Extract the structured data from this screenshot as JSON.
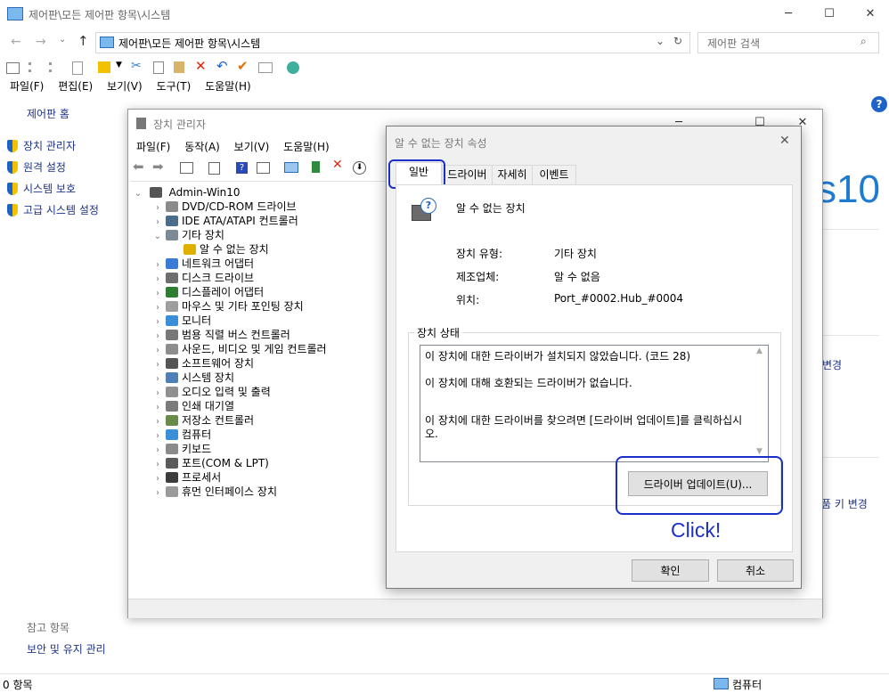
{
  "main_window": {
    "title": "제어판\\모든 제어판 항목\\시스템",
    "address": "제어판\\모든 제어판 항목\\시스템",
    "search_placeholder": "제어판 검색",
    "menu": [
      "파일(F)",
      "편집(E)",
      "보기(V)",
      "도구(T)",
      "도움말(H)"
    ],
    "left_home": "제어판 홈",
    "left_links": [
      "장치 관리자",
      "원격 설정",
      "시스템 보호",
      "고급 시스템 설정"
    ],
    "see_also": "참고 항목",
    "see_also_link": "보안 및 유지 관리",
    "win10_text": "s10",
    "change_link": "변경",
    "product_key_link": "품 키 변경",
    "status_left": "0 항목",
    "status_right": "컴퓨터"
  },
  "device_manager": {
    "title": "장치 관리자",
    "menu": [
      "파일(F)",
      "동작(A)",
      "보기(V)",
      "도움말(H)"
    ],
    "root": "Admin-Win10",
    "items": [
      {
        "label": "DVD/CD-ROM 드라이브",
        "expanded": false,
        "level": 1,
        "color": "#8a8a8a"
      },
      {
        "label": "IDE ATA/ATAPI 컨트롤러",
        "expanded": false,
        "level": 1,
        "color": "#4a6d8c"
      },
      {
        "label": "기타 장치",
        "expanded": true,
        "level": 1,
        "color": "#7c8a96"
      },
      {
        "label": "알 수 없는 장치",
        "expanded": null,
        "level": 2,
        "color": "#e0b000"
      },
      {
        "label": "네트워크 어댑터",
        "expanded": false,
        "level": 1,
        "color": "#3a7bd5"
      },
      {
        "label": "디스크 드라이브",
        "expanded": false,
        "level": 1,
        "color": "#6e6e6e"
      },
      {
        "label": "디스플레이 어댑터",
        "expanded": false,
        "level": 1,
        "color": "#2e7d32"
      },
      {
        "label": "마우스 및 기타 포인팅 장치",
        "expanded": false,
        "level": 1,
        "color": "#9e9e9e"
      },
      {
        "label": "모니터",
        "expanded": false,
        "level": 1,
        "color": "#3a8fd8"
      },
      {
        "label": "범용 직렬 버스 컨트롤러",
        "expanded": false,
        "level": 1,
        "color": "#777777"
      },
      {
        "label": "사운드, 비디오 및 게임 컨트롤러",
        "expanded": false,
        "level": 1,
        "color": "#8d8d8d"
      },
      {
        "label": "소프트웨어 장치",
        "expanded": false,
        "level": 1,
        "color": "#555555"
      },
      {
        "label": "시스템 장치",
        "expanded": false,
        "level": 1,
        "color": "#4e7fb5"
      },
      {
        "label": "오디오 입력 및 출력",
        "expanded": false,
        "level": 1,
        "color": "#909090"
      },
      {
        "label": "인쇄 대기열",
        "expanded": false,
        "level": 1,
        "color": "#7a7a7a"
      },
      {
        "label": "저장소 컨트롤러",
        "expanded": false,
        "level": 1,
        "color": "#6a8a4a"
      },
      {
        "label": "컴퓨터",
        "expanded": false,
        "level": 1,
        "color": "#3a8fd8"
      },
      {
        "label": "키보드",
        "expanded": false,
        "level": 1,
        "color": "#8a8a8a"
      },
      {
        "label": "포트(COM & LPT)",
        "expanded": false,
        "level": 1,
        "color": "#5a5a5a"
      },
      {
        "label": "프로세서",
        "expanded": false,
        "level": 1,
        "color": "#3c3c3c"
      },
      {
        "label": "휴먼 인터페이스 장치",
        "expanded": false,
        "level": 1,
        "color": "#9a9a9a"
      }
    ]
  },
  "properties_dialog": {
    "title": "알 수 없는 장치 속성",
    "tabs": [
      "일반",
      "드라이버",
      "자세히",
      "이벤트"
    ],
    "device_name": "알 수 없는 장치",
    "type_label": "장치 유형:",
    "type_value": "기타 장치",
    "mfr_label": "제조업체:",
    "mfr_value": "알 수 없음",
    "loc_label": "위치:",
    "loc_value": "Port_#0002.Hub_#0004",
    "status_group": "장치 상태",
    "status_lines": [
      "이 장치에 대한 드라이버가 설치되지 않았습니다. (코드 28)",
      "이 장치에 대해 호환되는 드라이버가 없습니다.",
      "이 장치에 대한 드라이버를 찾으려면 [드라이버 업데이트]를 클릭하십시오."
    ],
    "update_button": "드라이버 업데이트(U)...",
    "ok": "확인",
    "cancel": "취소"
  },
  "annotation": {
    "text": "Click!",
    "color": "#1a2fc9"
  }
}
